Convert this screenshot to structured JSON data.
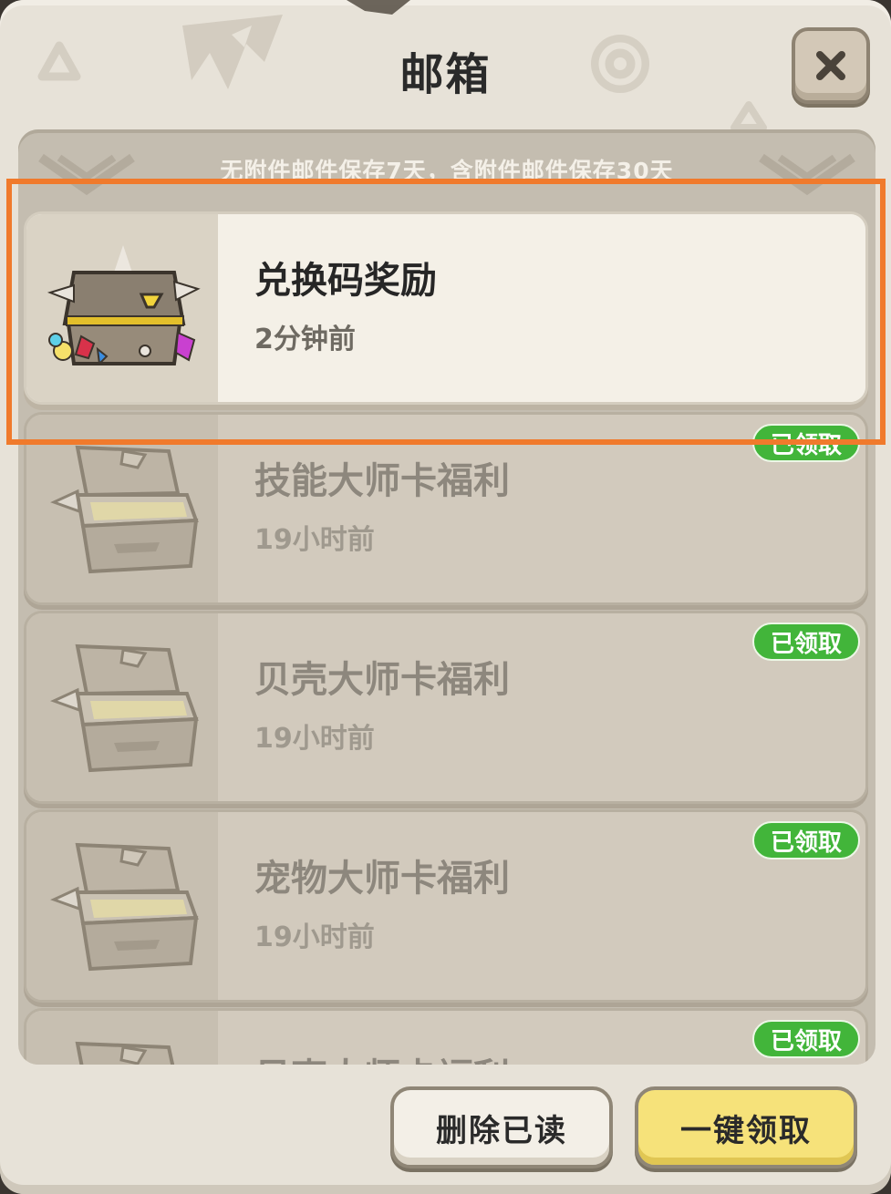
{
  "dialog": {
    "title": "邮箱",
    "notice": "无附件邮件保存7天，含附件邮件保存30天"
  },
  "mails": [
    {
      "title": "兑换码奖励",
      "time": "2分钟前",
      "status": "unread",
      "chest": "closed-chest-icon"
    },
    {
      "title": "技能大师卡福利",
      "time": "19小时前",
      "status": "claimed",
      "badge": "已领取",
      "chest": "open-chest-icon"
    },
    {
      "title": "贝壳大师卡福利",
      "time": "19小时前",
      "status": "claimed",
      "badge": "已领取",
      "chest": "open-chest-icon"
    },
    {
      "title": "宠物大师卡福利",
      "time": "19小时前",
      "status": "claimed",
      "badge": "已领取",
      "chest": "open-chest-icon"
    },
    {
      "title": "贝壳大师卡福利",
      "status": "claimed",
      "badge": "已领取",
      "chest": "open-chest-icon"
    }
  ],
  "buttons": {
    "delete_read": "删除已读",
    "claim_all": "一键领取"
  },
  "colors": {
    "panel": "#e7e2d8",
    "badge_green": "#42b53a",
    "claim_yellow": "#f6e27a",
    "highlight_orange": "#f07a2c"
  }
}
